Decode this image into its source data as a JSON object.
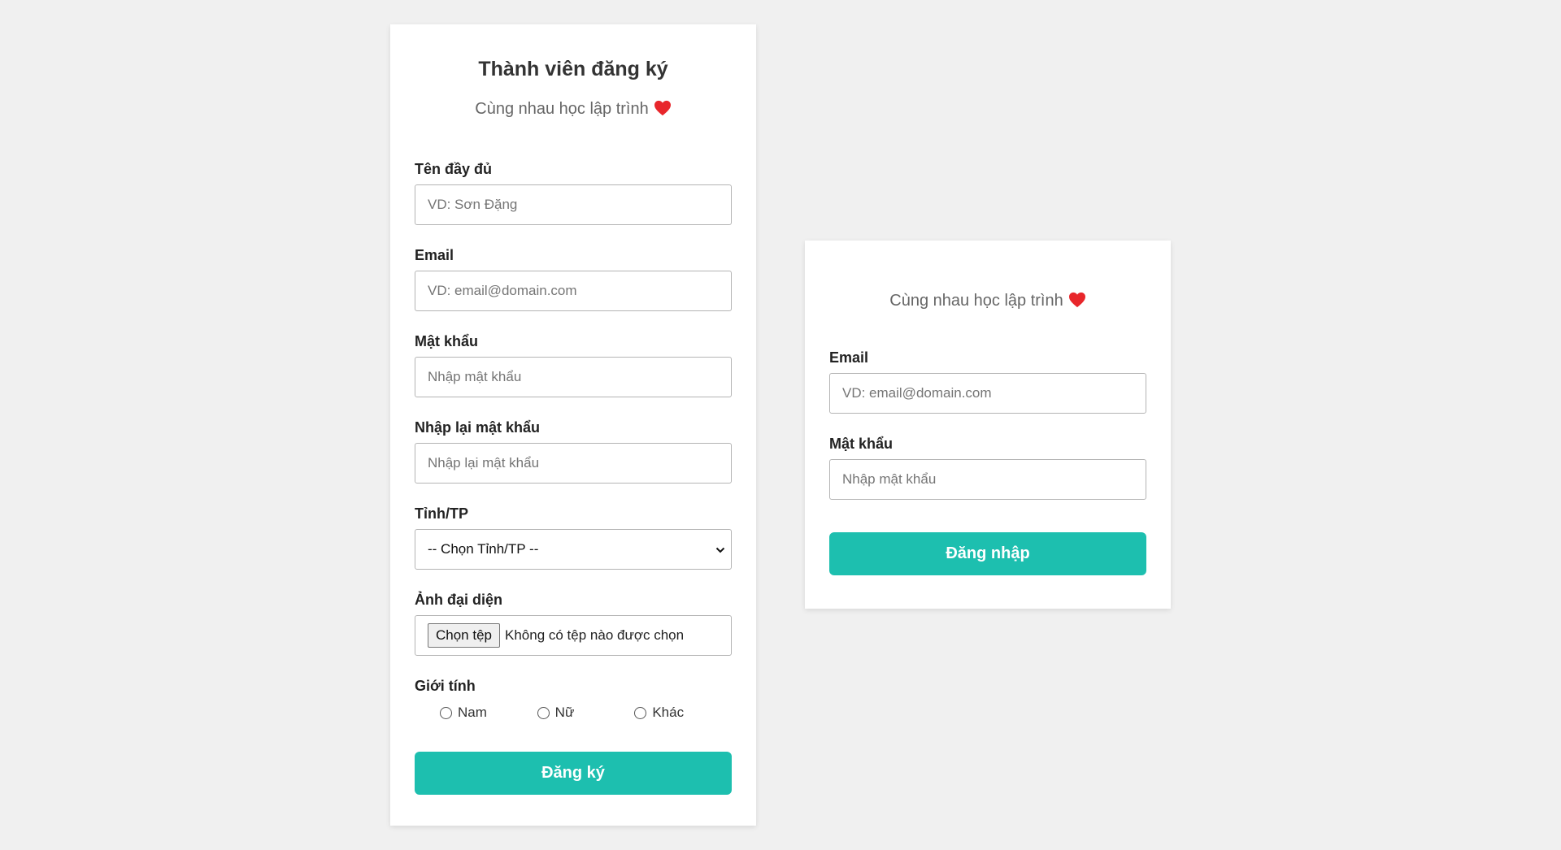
{
  "register": {
    "title": "Thành viên đăng ký",
    "description": "Cùng nhau học lập trình",
    "fullname": {
      "label": "Tên đầy đủ",
      "placeholder": "VD: Sơn Đặng"
    },
    "email": {
      "label": "Email",
      "placeholder": "VD: email@domain.com"
    },
    "password": {
      "label": "Mật khẩu",
      "placeholder": "Nhập mật khẩu"
    },
    "password_confirm": {
      "label": "Nhập lại mật khẩu",
      "placeholder": "Nhập lại mật khẩu"
    },
    "province": {
      "label": "Tỉnh/TP",
      "selected": "-- Chọn Tỉnh/TP --"
    },
    "avatar": {
      "label": "Ảnh đại diện",
      "button_label": "Chọn tệp",
      "status": "Không có tệp nào được chọn"
    },
    "gender": {
      "label": "Giới tính",
      "options": [
        {
          "label": "Nam"
        },
        {
          "label": "Nữ"
        },
        {
          "label": "Khác"
        }
      ]
    },
    "submit_label": "Đăng ký"
  },
  "login": {
    "description": "Cùng nhau học lập trình",
    "email": {
      "label": "Email",
      "placeholder": "VD: email@domain.com"
    },
    "password": {
      "label": "Mật khẩu",
      "placeholder": "Nhập mật khẩu"
    },
    "submit_label": "Đăng nhập"
  },
  "colors": {
    "page_background": "#f0f0f0",
    "card_background": "#ffffff",
    "accent": "#1dbfaf",
    "heart": "#e8262b"
  },
  "icons": {
    "heart": "heart-icon",
    "select_arrow": "chevron-down-icon"
  }
}
